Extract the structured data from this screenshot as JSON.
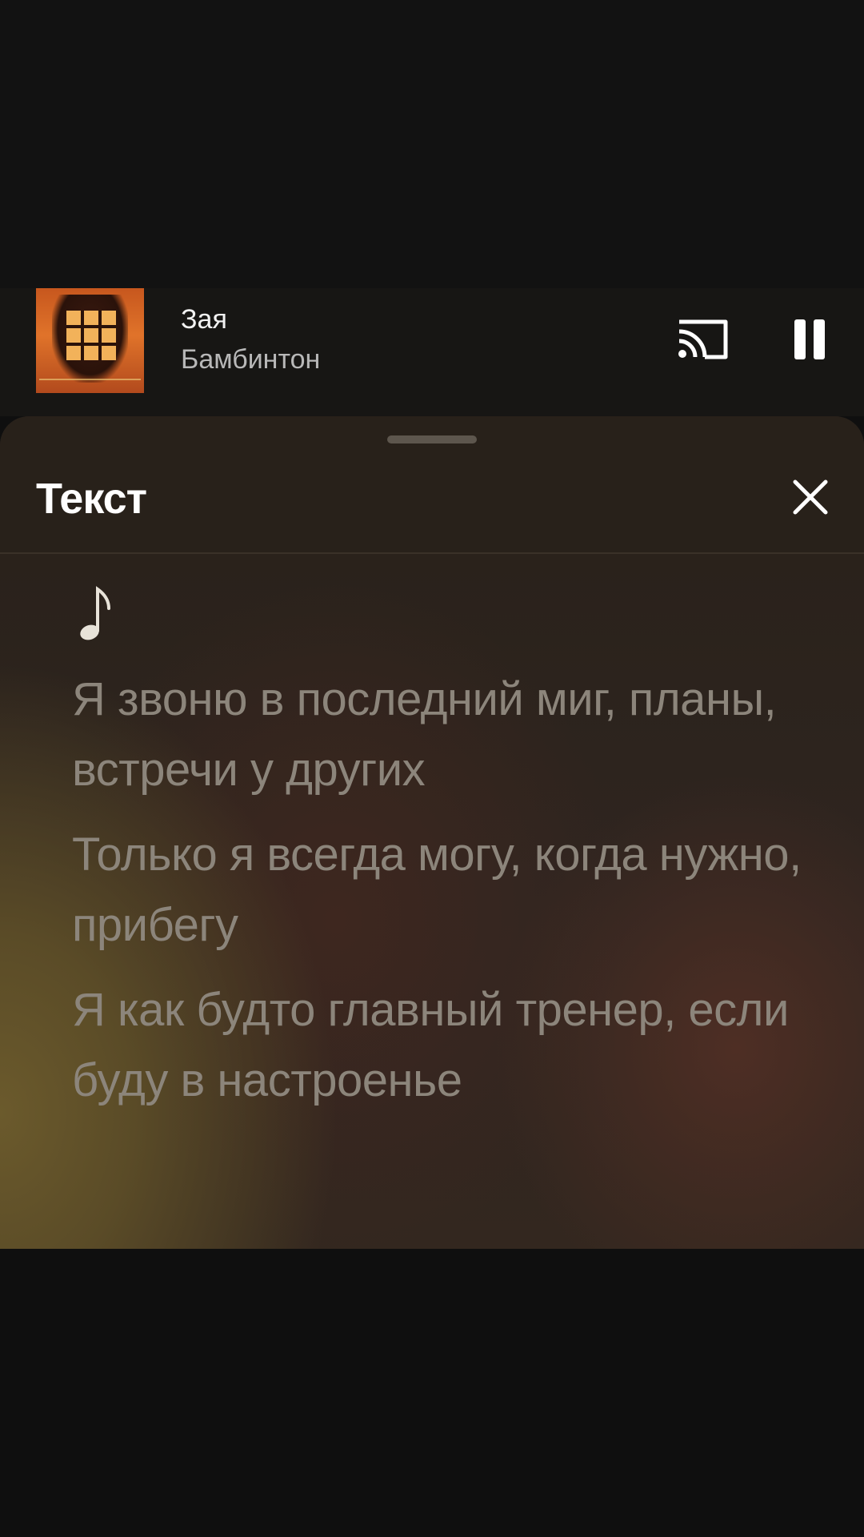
{
  "mini_player": {
    "track_title": "Зая",
    "artist": "Бамбинтон",
    "album_art_icon": "album-cover-art"
  },
  "controls": {
    "cast_icon": "cast-icon",
    "pause_icon": "pause-icon"
  },
  "lyrics_sheet": {
    "title": "Текст",
    "close_icon": "close-icon",
    "note_icon": "music-note-icon",
    "lines": [
      "Я звоню в последний миг, планы, встречи у других",
      "Только я всегда могу, когда нужно, прибегу",
      "Я как будто главный тренер, если буду в настроенье"
    ]
  },
  "colors": {
    "accent_text": "#ffffff",
    "lyric_text": "#8c857b",
    "sheet_bg": "#28211a"
  }
}
